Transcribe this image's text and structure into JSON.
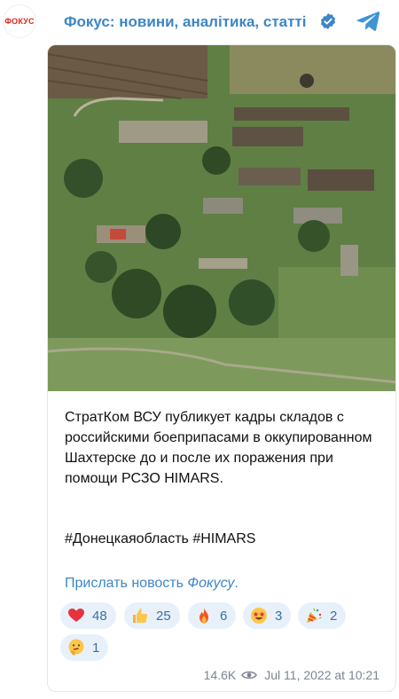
{
  "channel": {
    "avatar_text": "ФОКУС",
    "title": "Фокус: новини, аналітика, статті"
  },
  "post": {
    "text": "СтратКом ВСУ публикует кадры складов с российскими боеприпасами в оккупированном Шахтерске до и после их поражения при помощи РСЗО HIMARS.",
    "hashtags": "#Донецкаяобласть #HIMARS",
    "link_prefix": "Прислать новость ",
    "link_italic": "Фокусу",
    "link_suffix": ".",
    "reactions": [
      {
        "emoji": "heart",
        "count": "48"
      },
      {
        "emoji": "thumbs-up",
        "count": "25"
      },
      {
        "emoji": "fire",
        "count": "6"
      },
      {
        "emoji": "star-struck",
        "count": "3"
      },
      {
        "emoji": "party-popper",
        "count": "2"
      },
      {
        "emoji": "thinking-face",
        "count": "1"
      }
    ],
    "views": "14.6K",
    "date": "Jul 11, 2022 at 10:21"
  },
  "colors": {
    "accent": "#3d86c6",
    "reaction_bg": "#e8f1fa",
    "brand_red": "#e2231a"
  }
}
